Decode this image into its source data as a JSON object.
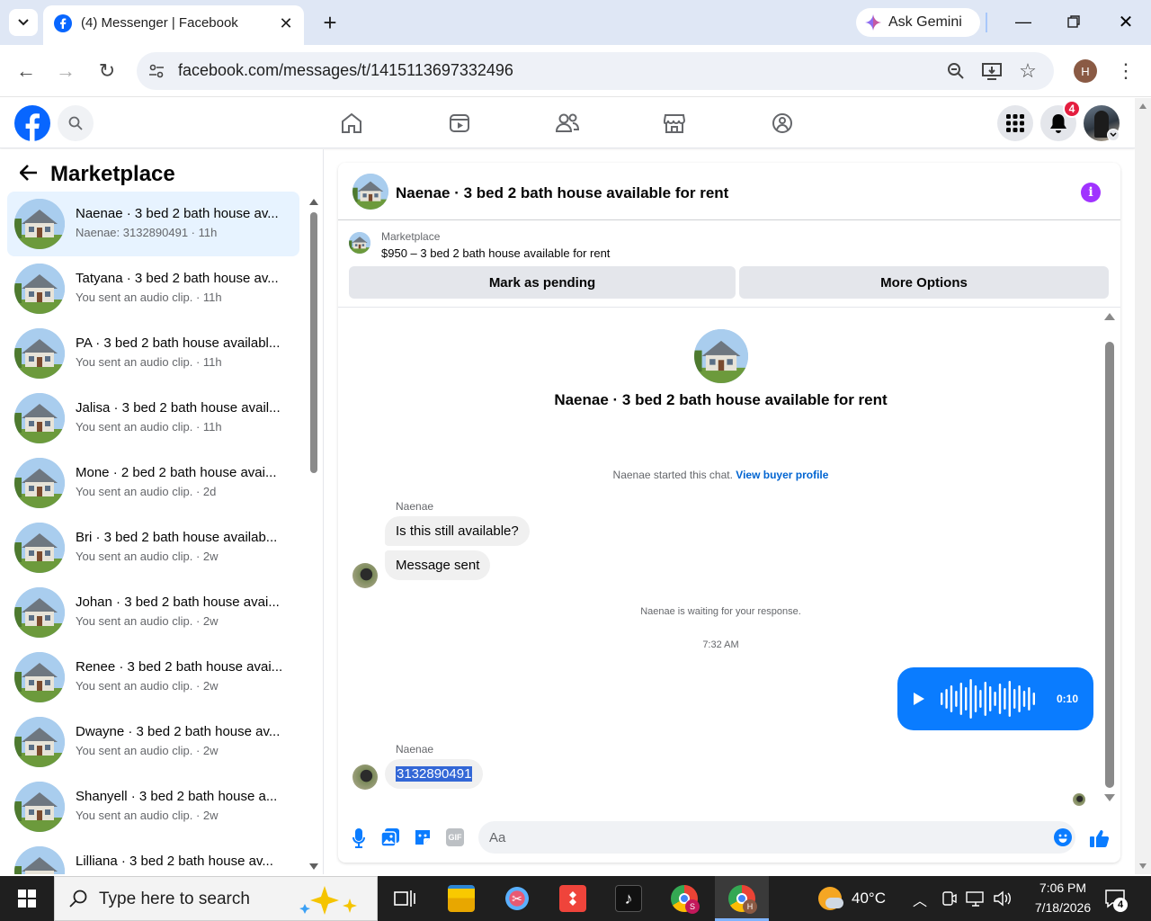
{
  "browser": {
    "tab_title": "(4) Messenger | Facebook",
    "new_tab": "+",
    "ask_gemini": "Ask Gemini",
    "url": "facebook.com/messages/t/1415113697332496",
    "profile_initial": "H"
  },
  "fb_header": {
    "notification_count": "4"
  },
  "sidebar": {
    "title": "Marketplace",
    "conversations": [
      {
        "title": "Naenae · 3 bed 2 bath house av...",
        "subtitle": "Naenae: 3132890491 · 11h",
        "selected": true
      },
      {
        "title": "Tatyana · 3 bed 2 bath house av...",
        "subtitle": "You sent an audio clip. · 11h"
      },
      {
        "title": "PA · 3 bed 2 bath house availabl...",
        "subtitle": "You sent an audio clip. · 11h"
      },
      {
        "title": "Jalisa · 3 bed 2 bath house avail...",
        "subtitle": "You sent an audio clip. · 11h"
      },
      {
        "title": "Mone · 2 bed 2 bath house avai...",
        "subtitle": "You sent an audio clip. · 2d"
      },
      {
        "title": "Bri · 3 bed 2 bath house availab...",
        "subtitle": "You sent an audio clip. · 2w"
      },
      {
        "title": "Johan · 3 bed 2 bath house avai...",
        "subtitle": "You sent an audio clip. · 2w"
      },
      {
        "title": "Renee · 3 bed 2 bath house avai...",
        "subtitle": "You sent an audio clip. · 2w"
      },
      {
        "title": "Dwayne · 3 bed 2 bath house av...",
        "subtitle": "You sent an audio clip. · 2w"
      },
      {
        "title": "Shanyell · 3 bed 2 bath house a...",
        "subtitle": "You sent an audio clip. · 2w"
      },
      {
        "title": "Lilliana · 3 bed 2 bath house av...",
        "subtitle": ""
      }
    ]
  },
  "chat": {
    "header_title": "Naenae · 3 bed 2 bath house available for rent",
    "listing_source": "Marketplace",
    "listing_text": "$950 – 3 bed 2 bath house available for rent",
    "mark_pending": "Mark as pending",
    "more_options": "More Options",
    "intro_title": "Naenae · 3 bed 2 bath house available for rent",
    "started_text": "Naenae started this chat.",
    "view_profile": "View buyer profile",
    "sender_name_1": "Naenae",
    "msg_1": "Is this still available?",
    "msg_2": "Message sent",
    "waiting_text": "Naenae is waiting for your response.",
    "timestamp": "7:32 AM",
    "audio_duration": "0:10",
    "sender_name_2": "Naenae",
    "msg_3": "3132890491",
    "composer_placeholder": "Aa"
  },
  "taskbar": {
    "search_placeholder": "Type here to search",
    "weather": "40°C",
    "time": "7:06 PM",
    "date": "7/18/2026",
    "notif_count": "4"
  },
  "colors": {
    "fb_blue": "#0866ff",
    "messenger_blue": "#0a7cff",
    "selected_bg": "#e7f3ff",
    "info_purple": "#a033ff"
  }
}
